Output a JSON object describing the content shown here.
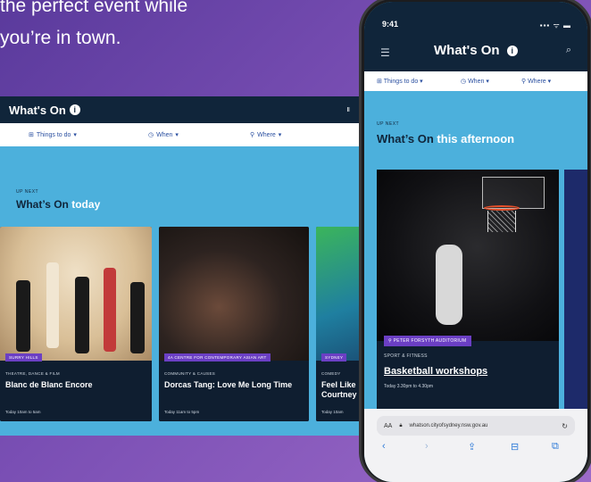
{
  "promo": {
    "line1": "the perfect event while",
    "line2": "you’re in town."
  },
  "desktop": {
    "title": "What's On",
    "header_mark": "Ⅱ",
    "filters": [
      "Things to do",
      "When",
      "Where",
      ""
    ],
    "up_next": "UP NEXT",
    "heading_prefix": "What’s On",
    "heading_highlight": "today",
    "cards": [
      {
        "chip": "SURRY HILLS",
        "category": "THEATRE, DANCE & FILM",
        "title": "Blanc de Blanc Encore",
        "time": "Today 10am to 5am"
      },
      {
        "chip": "4A CENTRE FOR CONTEMPORARY ASIAN ART",
        "category": "COMMUNITY & CAUSES",
        "title": "Dorcas Tang: Love Me Long Time",
        "time": "Today 11am to 5pm"
      },
      {
        "chip": "SYDNEY",
        "category": "COMEDY",
        "title": "Feel Like Courtney",
        "time": "Today 10am"
      }
    ]
  },
  "phone": {
    "time": "9:41",
    "status": "▪▪▪ ᯤ ▬",
    "title": "What's On",
    "filters": [
      "Things to do",
      "When",
      "Where"
    ],
    "up_next": "UP NEXT",
    "heading_prefix": "What’s On",
    "heading_highlight": "this afternoon",
    "card": {
      "chip": "PETER FORSYTH AUDITORIUM",
      "category": "SPORT & FITNESS",
      "title": "Basketball workshops",
      "time": "Today 3.30pm to 4.30pm"
    },
    "url_aa": "AA",
    "url": "whatson.cityofsydney.nsw.gov.au"
  },
  "colors": {
    "background": "#7a4fb4",
    "site_header": "#10253a",
    "site_body": "#4cb0dc",
    "chip": "#6b3fc4",
    "link": "#2f7bd8"
  }
}
